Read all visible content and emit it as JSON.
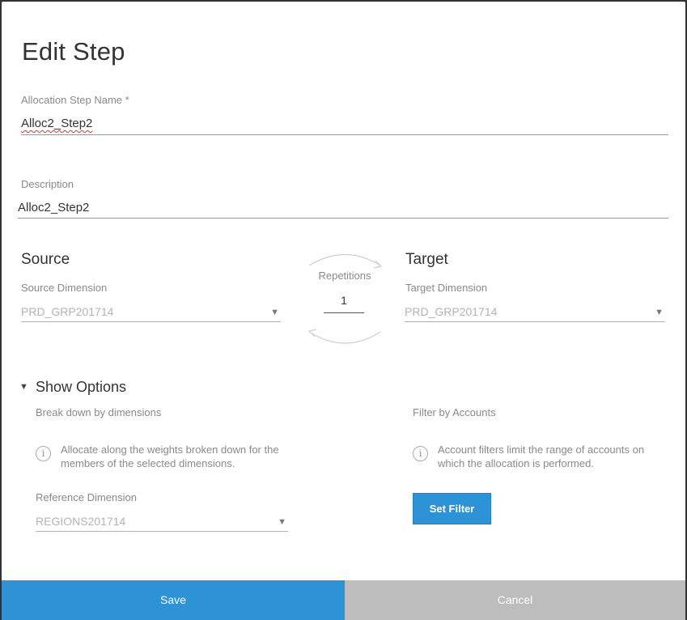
{
  "dialog": {
    "title": "Edit Step",
    "step_name": {
      "label": "Allocation Step Name *",
      "value": "Alloc2_Step2"
    },
    "description": {
      "label": "Description",
      "value": "Alloc2_Step2"
    },
    "source": {
      "heading": "Source",
      "dimension_label": "Source Dimension",
      "dimension_value": "PRD_GRP201714"
    },
    "repetitions": {
      "label": "Repetitions",
      "value": "1"
    },
    "target": {
      "heading": "Target",
      "dimension_label": "Target Dimension",
      "dimension_value": "PRD_GRP201714"
    },
    "options": {
      "toggle_label": "Show Options",
      "breakdown": {
        "heading": "Break down by dimensions",
        "info_line1": "Allocate along the weights broken down for the",
        "info_line2": "members of the selected dimensions.",
        "ref_label": "Reference Dimension",
        "ref_value": "REGIONS201714"
      },
      "filter": {
        "heading": "Filter by Accounts",
        "info_line1": "Account filters limit the range of accounts on",
        "info_line2": "which the allocation is performed.",
        "button_label": "Set Filter"
      }
    },
    "footer": {
      "save_label": "Save",
      "cancel_label": "Cancel"
    }
  }
}
